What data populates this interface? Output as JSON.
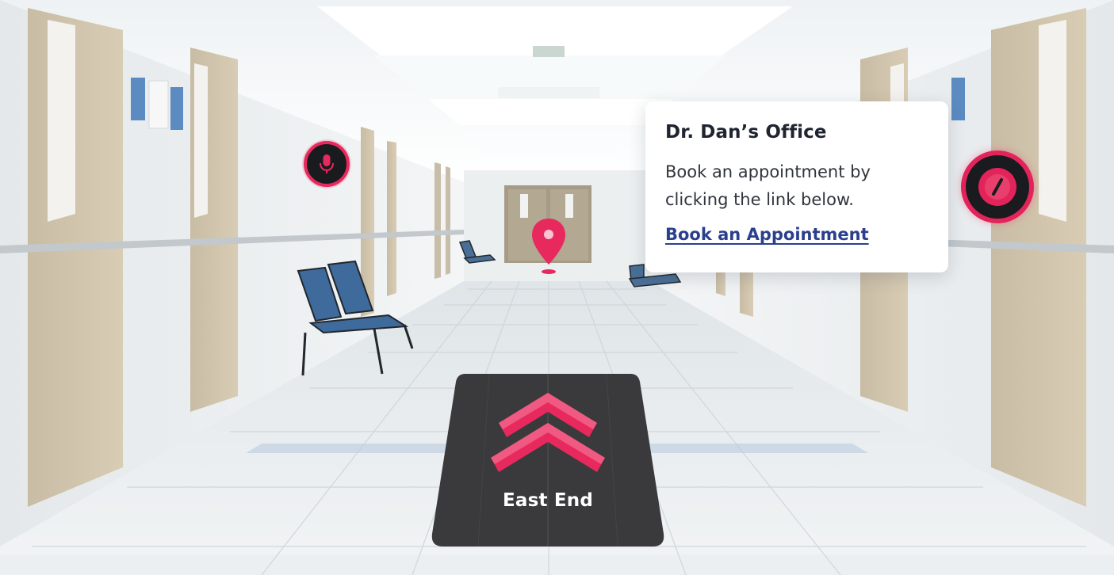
{
  "info_card": {
    "title": "Dr. Dan’s Office",
    "body_line1": "Book an appointment by",
    "body_line2": "clicking the link below.",
    "link_label": "Book an Appointment"
  },
  "floor_sign": {
    "label": "East End"
  },
  "icons": {
    "microphone": "microphone-icon",
    "stop": "stop-icon",
    "location_pin": "location-pin-icon",
    "arrows": "double-chevron-up-icon"
  },
  "colors": {
    "accent": "#e8295e",
    "link": "#2b3f8f",
    "sign_background": "#3a3a3c",
    "card_background": "#ffffff"
  }
}
